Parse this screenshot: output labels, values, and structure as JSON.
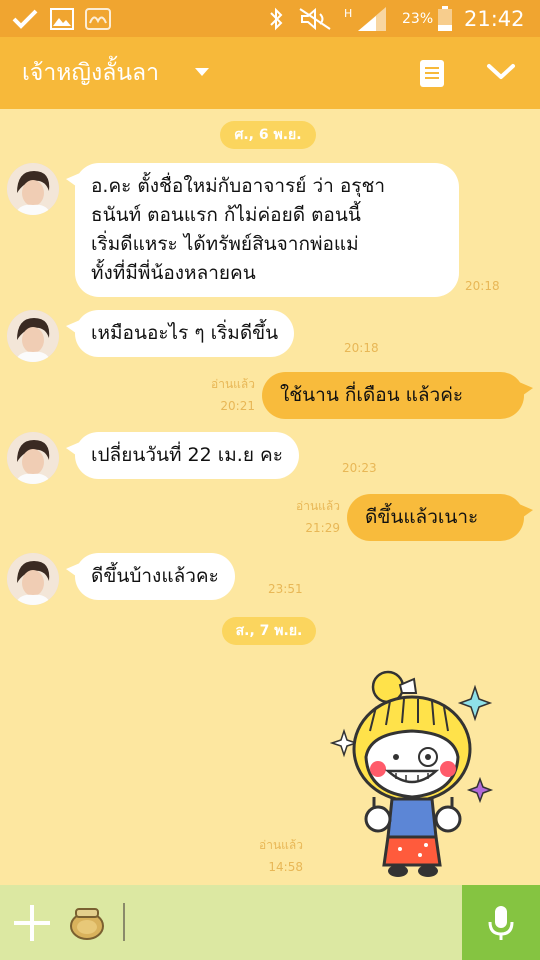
{
  "status_bar": {
    "battery_percent": "23%",
    "time": "21:42",
    "icons": [
      "check-icon",
      "image-icon",
      "app-notification-icon",
      "bluetooth-icon",
      "mute-icon",
      "signal-icon",
      "battery-icon"
    ]
  },
  "header": {
    "title": "เจ้าหญิงลั้นลา",
    "icons": [
      "dropdown-caret-icon",
      "notes-icon",
      "chevron-down-icon"
    ]
  },
  "chat": {
    "date_separators": [
      "ศ., 6 พ.ย.",
      "ส., 7 พ.ย."
    ],
    "messages": [
      {
        "direction": "in",
        "lines": [
          "อ.คะ ตั้งชื่อใหม่กับอาจารย์ ว่า อรุชา",
          "ธนันท์ ตอนแรก ก้ไม่ค่อยดี ตอนนี้",
          "เริ่มดีแหระ ได้ทรัพย์สินจากพ่อแม่",
          "ทั้งที่มีพี่น้องหลายคน"
        ],
        "time": "20:18"
      },
      {
        "direction": "in",
        "lines": [
          "เหมือนอะไร ๆ เริ่มดีขึ้น"
        ],
        "time": "20:18"
      },
      {
        "direction": "out",
        "lines": [
          "ใช้นาน กี่เดือน แล้วค่ะ"
        ],
        "read": "อ่านแล้ว",
        "time": "20:21"
      },
      {
        "direction": "in",
        "lines": [
          "เปลี่ยนวันที่ 22 เม.ย คะ"
        ],
        "time": "20:23"
      },
      {
        "direction": "out",
        "lines": [
          "ดีขึ้นแล้วเนาะ"
        ],
        "read": "อ่านแล้ว",
        "time": "21:29"
      },
      {
        "direction": "in",
        "lines": [
          "ดีขึ้นบ้างแล้วคะ"
        ],
        "time": "23:51"
      },
      {
        "direction": "out",
        "type": "sticker",
        "sticker": "blonde-girl-thumbs-up-sticker",
        "read": "อ่านแล้ว",
        "time": "14:58"
      }
    ]
  },
  "input_bar": {
    "text_value": "",
    "icons": [
      "plus-icon",
      "sticker-jar-icon",
      "microphone-icon"
    ]
  },
  "colors": {
    "status_bar": "#f0a530",
    "header": "#f7b93a",
    "chat_background": "#fde7a0",
    "bubble_in": "#ffffff",
    "bubble_out": "#f8bb3c",
    "date_pill": "#fbd55e",
    "meta_text": "#e8b756",
    "input_bar": "#dce8a2",
    "mic_button": "#85c441"
  }
}
